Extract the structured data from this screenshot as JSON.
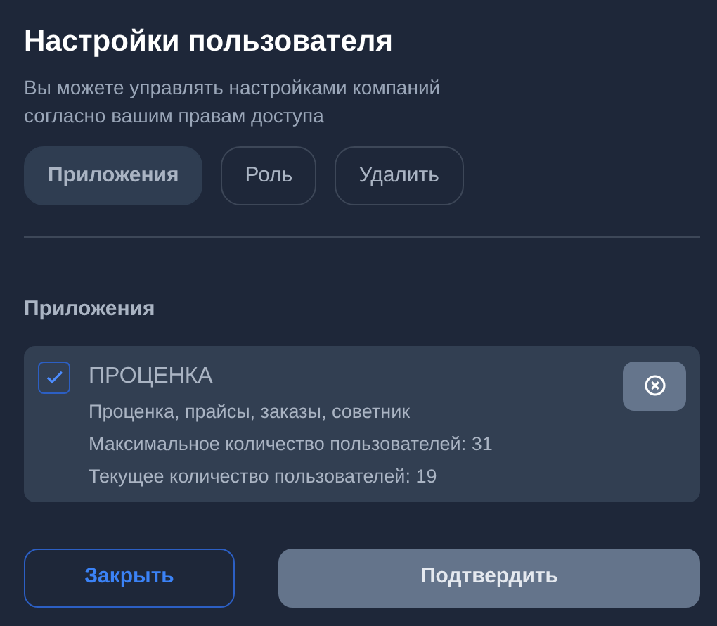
{
  "title": "Настройки пользователя",
  "subtitle": "Вы можете управлять настройками компаний согласно вашим правам доступа",
  "tabs": [
    {
      "label": "Приложения",
      "selected": true
    },
    {
      "label": "Роль",
      "selected": false
    },
    {
      "label": "Удалить",
      "selected": false
    }
  ],
  "section_title": "Приложения",
  "apps": [
    {
      "name": "ПРОЦЕНКА",
      "checked": true,
      "details": [
        "Проценка, прайсы, заказы, советник",
        "Максимальное количество пользователей: 31",
        "Текущее количество пользователей: 19"
      ]
    }
  ],
  "buttons": [
    {
      "kind": "secondary",
      "label": "Закрыть"
    },
    {
      "kind": "primary",
      "label": "Подтвердить",
      "disabled": true
    }
  ]
}
